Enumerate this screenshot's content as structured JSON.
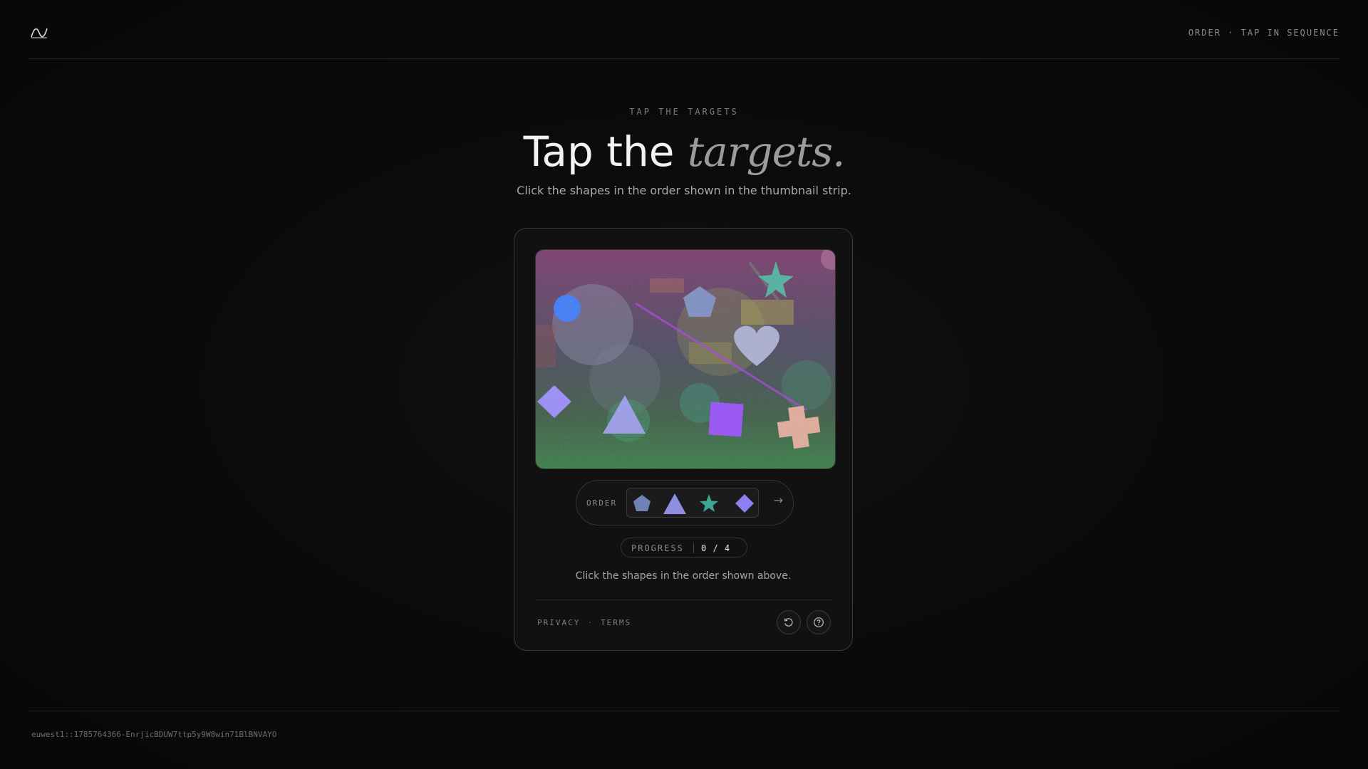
{
  "header": {
    "right_label": "ORDER · TAP IN SEQUENCE",
    "logo_icon": "wave-logo-icon"
  },
  "hero": {
    "eyebrow": "TAP THE TARGETS",
    "title_main": "Tap the",
    "title_accent": "targets.",
    "subtitle": "Click the shapes in the order shown in the thumbnail strip."
  },
  "card": {
    "order_label": "ORDER",
    "order_sequence": [
      "pentagon-icon",
      "triangle-icon",
      "star-icon",
      "diamond-icon"
    ],
    "next_arrow": "→",
    "progress_label": "PROGRESS",
    "progress_value": "0 / 4",
    "progress": {
      "done": 0,
      "total": 4
    },
    "instruction": "Click the shapes in the order shown above.",
    "links": {
      "privacy": "PRIVACY",
      "sep": "·",
      "terms": "TERMS"
    },
    "buttons": [
      "refresh-icon",
      "help-icon"
    ]
  },
  "footer": {
    "session_id": "euwest1::1785764366-EnrjicBDUW7ttp5y9W8win71BlBNVAYO"
  },
  "colors": {
    "background": "#0a0a0a",
    "pentagon": "#6f82b8",
    "triangle": "#8e8fe0",
    "star": "#3fa593",
    "diamond": "#8d7ff2",
    "square": "#8a3ff0",
    "circle": "#2d6cf0",
    "cross": "#d8a08e",
    "heart": "#9fa4c6"
  }
}
